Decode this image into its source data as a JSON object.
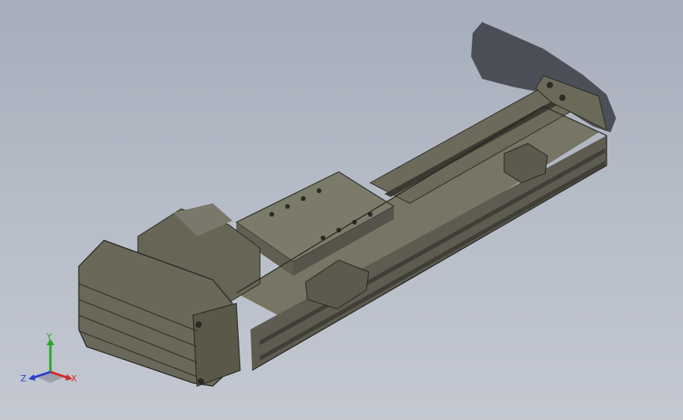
{
  "viewport": {
    "background_top": "#a6adbb",
    "background_bottom": "#c3c8d1",
    "model_color": "#6e6b5e",
    "model_shadow": "#45473f",
    "model_highlight": "#8d8a7a"
  },
  "triad": {
    "y_label": "Y",
    "z_label": "Z",
    "x_label": "X",
    "y_color": "#2aa52a",
    "z_color": "#2a3fd1",
    "x_color": "#d12a2a"
  }
}
